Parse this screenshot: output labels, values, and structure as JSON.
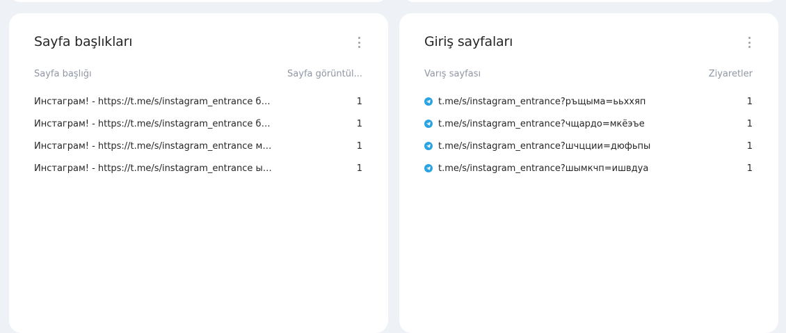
{
  "colors": {
    "page_bg": "#eef1f6",
    "card_bg": "#ffffff",
    "text": "#262626",
    "muted": "#8f96a3",
    "telegram": "#2aa3e0"
  },
  "widgets": [
    {
      "title": "Sayfa başlıkları",
      "columns": {
        "left": "Sayfa başlığı",
        "right": "Sayfa görüntül..."
      },
      "rows": [
        {
          "label": "Инстаграм! - https://t.me/s/instagram_entrance бйф...",
          "value": "1"
        },
        {
          "label": "Инстаграм! - https://t.me/s/instagram_entrance боо...",
          "value": "1"
        },
        {
          "label": "Инстаграм! - https://t.me/s/instagram_entrance мик...",
          "value": "1"
        },
        {
          "label": "Инстаграм! - https://t.me/s/instagram_entrance ырб...",
          "value": "1"
        }
      ]
    },
    {
      "title": "Giriş sayfaları",
      "columns": {
        "left": "Varış sayfası",
        "right": "Ziyaretler"
      },
      "row_icon": "telegram-icon",
      "rows": [
        {
          "label": "t.me/s/instagram_entrance?ръщыма=ььххяп",
          "value": "1"
        },
        {
          "label": "t.me/s/instagram_entrance?чщардо=мкёэъе",
          "value": "1"
        },
        {
          "label": "t.me/s/instagram_entrance?шчцции=дюфьпы",
          "value": "1"
        },
        {
          "label": "t.me/s/instagram_entrance?шымкчп=ишвдуа",
          "value": "1"
        }
      ]
    }
  ]
}
